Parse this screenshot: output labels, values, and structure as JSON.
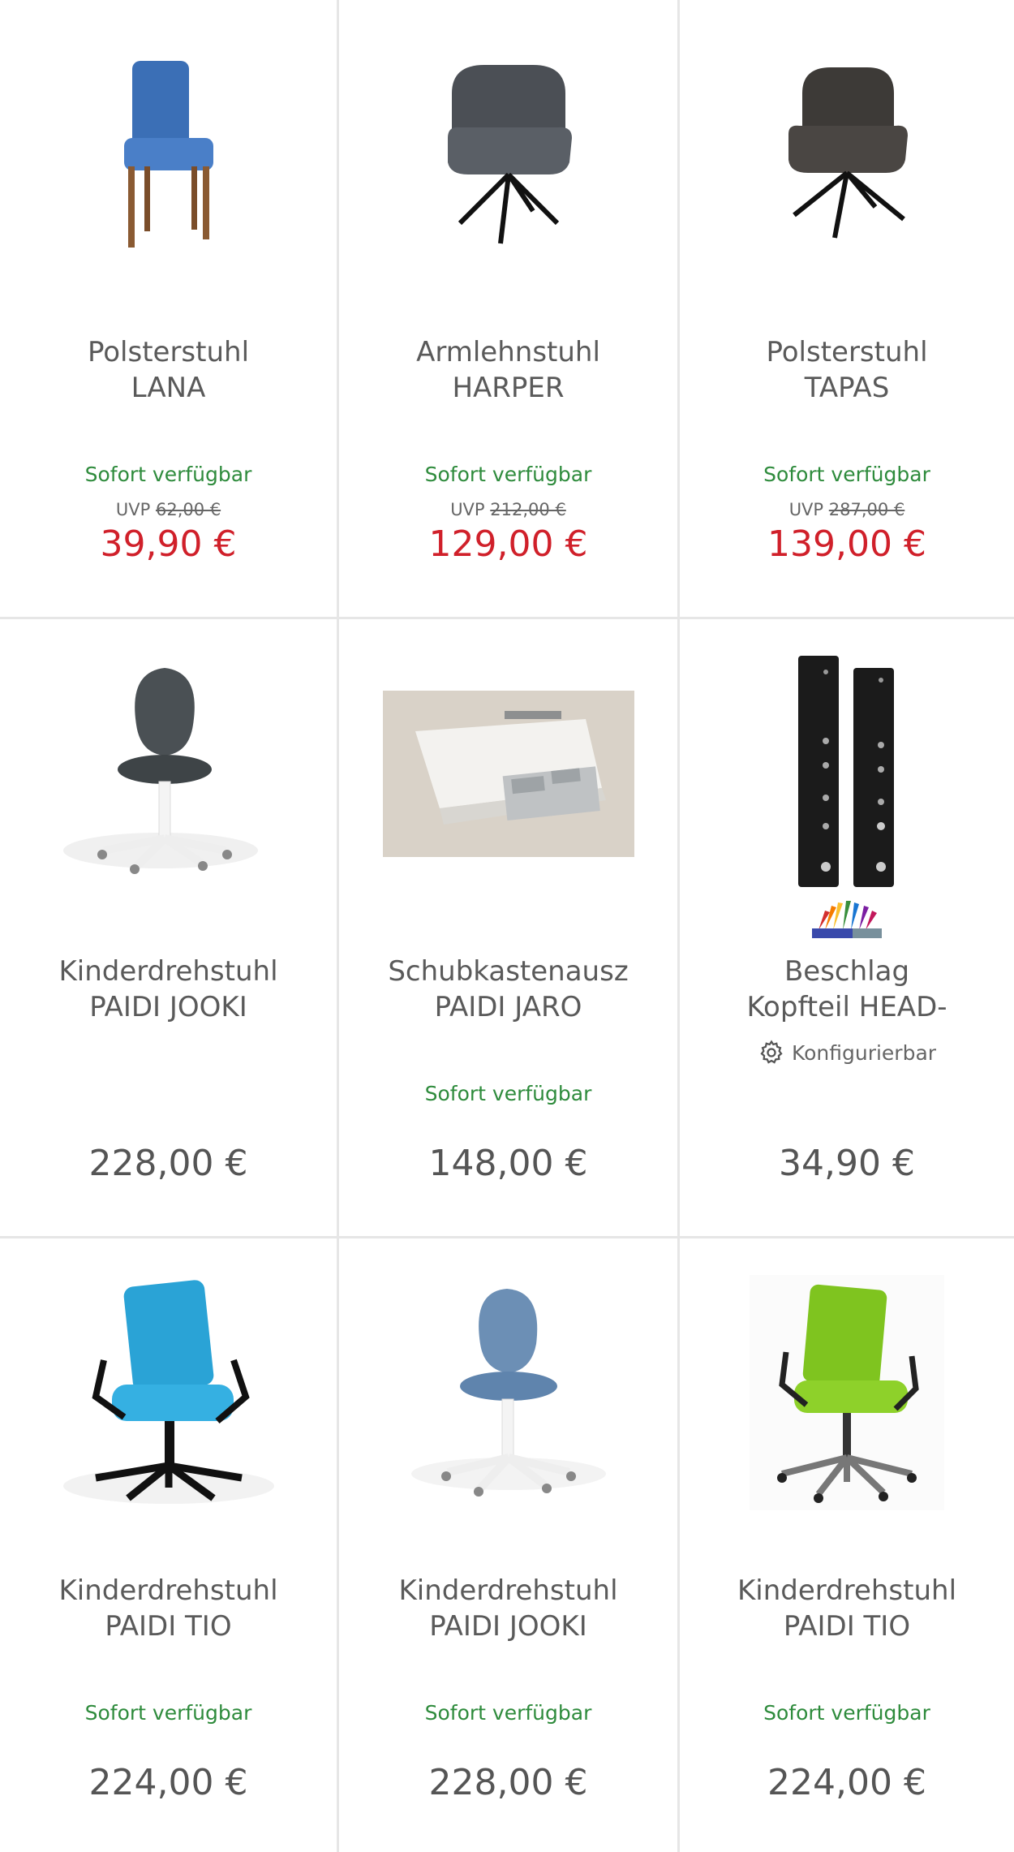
{
  "products": [
    {
      "line1": "Polsterstuhl",
      "line2": "LANA",
      "availability": "Sofort verfügbar",
      "uvp_label": "UVP",
      "uvp_price": "62,00 €",
      "price": "39,90 €",
      "sale": true,
      "image": "blue-upholstered-chair",
      "color": "#3b6fb6"
    },
    {
      "line1": "Armlehnstuhl",
      "line2": "HARPER",
      "availability": "Sofort verfügbar",
      "uvp_label": "UVP",
      "uvp_price": "212,00 €",
      "price": "129,00 €",
      "sale": true,
      "image": "grey-armchair-swivel",
      "color": "#4b4f55"
    },
    {
      "line1": "Polsterstuhl",
      "line2": "TAPAS",
      "availability": "Sofort verfügbar",
      "uvp_label": "UVP",
      "uvp_price": "287,00 €",
      "price": "139,00 €",
      "sale": true,
      "image": "brown-armchair-swivel",
      "color": "#3d3a37"
    },
    {
      "line1": "Kinderdrehstuhl",
      "line2": "PAIDI JOOKI",
      "availability": "",
      "uvp_label": "",
      "uvp_price": "",
      "price": "228,00 €",
      "sale": false,
      "image": "grey-kids-swivel-chair",
      "color": "#4a5054"
    },
    {
      "line1": "Schubkastenausz",
      "line2": "PAIDI JARO",
      "availability": "Sofort verfügbar",
      "uvp_label": "",
      "uvp_price": "",
      "price": "148,00 €",
      "sale": false,
      "image": "desk-drawer-photo",
      "color": "#e8e4dd"
    },
    {
      "line1": "Beschlag",
      "line2": "Kopfteil HEAD-",
      "availability": "",
      "uvp_label": "",
      "uvp_price": "",
      "price": "34,90 €",
      "sale": false,
      "configurable": "Konfigurierbar",
      "image": "black-fitting-rails",
      "color": "#1b1b1b"
    },
    {
      "line1": "Kinderdrehstuhl",
      "line2": "PAIDI TIO",
      "availability": "Sofort verfügbar",
      "uvp_label": "",
      "uvp_price": "",
      "price": "224,00 €",
      "sale": false,
      "image": "cyan-office-chair",
      "color": "#2aa3d6"
    },
    {
      "line1": "Kinderdrehstuhl",
      "line2": "PAIDI JOOKI",
      "availability": "Sofort verfügbar",
      "uvp_label": "",
      "uvp_price": "",
      "price": "228,00 €",
      "sale": false,
      "image": "blue-kids-swivel-chair",
      "color": "#6c8fb5"
    },
    {
      "line1": "Kinderdrehstuhl",
      "line2": "PAIDI TIO",
      "availability": "Sofort verfügbar",
      "uvp_label": "",
      "uvp_price": "",
      "price": "224,00 €",
      "sale": false,
      "image": "green-office-chair",
      "color": "#7fc41f"
    }
  ]
}
